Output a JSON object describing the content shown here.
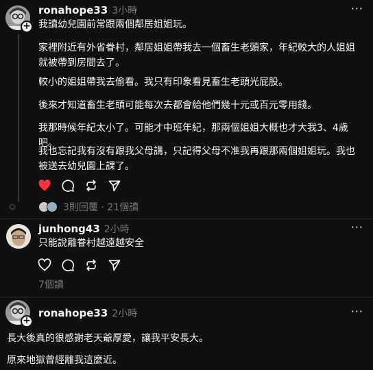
{
  "posts": [
    {
      "username": "ronahope33",
      "time": "3小時",
      "more": "···",
      "paragraphs": [
        "我讀幼兒園前常跟兩個鄰居姐姐玩。",
        "家裡附近有外省眷村，鄰居姐姐帶我去一個畜生老頭家，年紀較大的人姐姐就被帶到房間去了。",
        "較小的姐姐帶我去偷看。我只有印象看見畜生老頭光屁股。",
        "後來才知道畜生老頭可能每次去都會給他們幾十元或百元零用錢。",
        "我那時候年紀太小了。可能才中班年紀，那兩個姐姐大概也才大我3、4歲吧。",
        "我也忘記我有沒有跟我父母講，只記得父母不准我再跟那兩個姐姐玩。我也被送去幼兒園上課了。"
      ],
      "replies_text": "3則回覆",
      "views_text": "21個讀",
      "liked": true
    },
    {
      "username": "junhong43",
      "time": "2小時",
      "more": "···",
      "paragraphs": [
        "只能說離眷村越遠越安全"
      ],
      "views_text": "7個讀",
      "liked": false
    },
    {
      "username": "ronahope33",
      "time": "2小時",
      "more": "···",
      "paragraphs": [
        "長大後真的很感謝老天爺厚愛，讓我平安長大。",
        "原來地獄曾經離我這麼近。"
      ]
    }
  ],
  "separator": "·",
  "colors": {
    "background": "#101010",
    "text": "#f3f5f7",
    "secondary": "#777777",
    "like": "#ff3040"
  },
  "icons": [
    "heart-icon",
    "comment-icon",
    "repost-icon",
    "share-icon",
    "plus-icon",
    "more-icon"
  ]
}
